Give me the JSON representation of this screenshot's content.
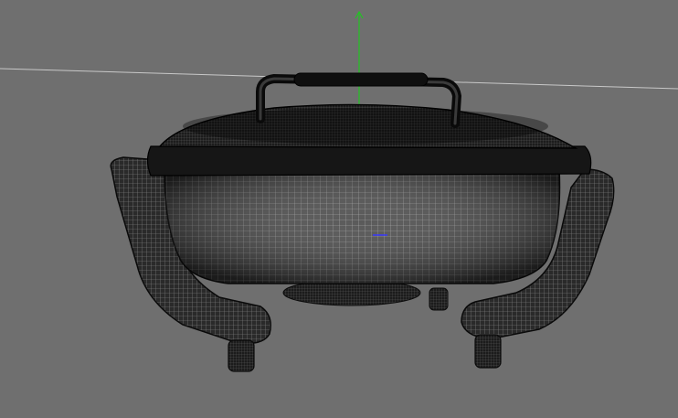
{
  "viewport": {
    "background": "#6f6f6f",
    "horizon_color": "#bdbdbd",
    "y_axis_color": "#22c422",
    "pivot_color": "#3a3aff",
    "wireframe_color": "#0a0a0a",
    "mesh_color": "#8a8a8a",
    "shaded_color": "#1a1a1a"
  },
  "scene": {
    "object_icon": "cooking-pot-icon",
    "display_mode": "wireframe-on-shaded"
  }
}
